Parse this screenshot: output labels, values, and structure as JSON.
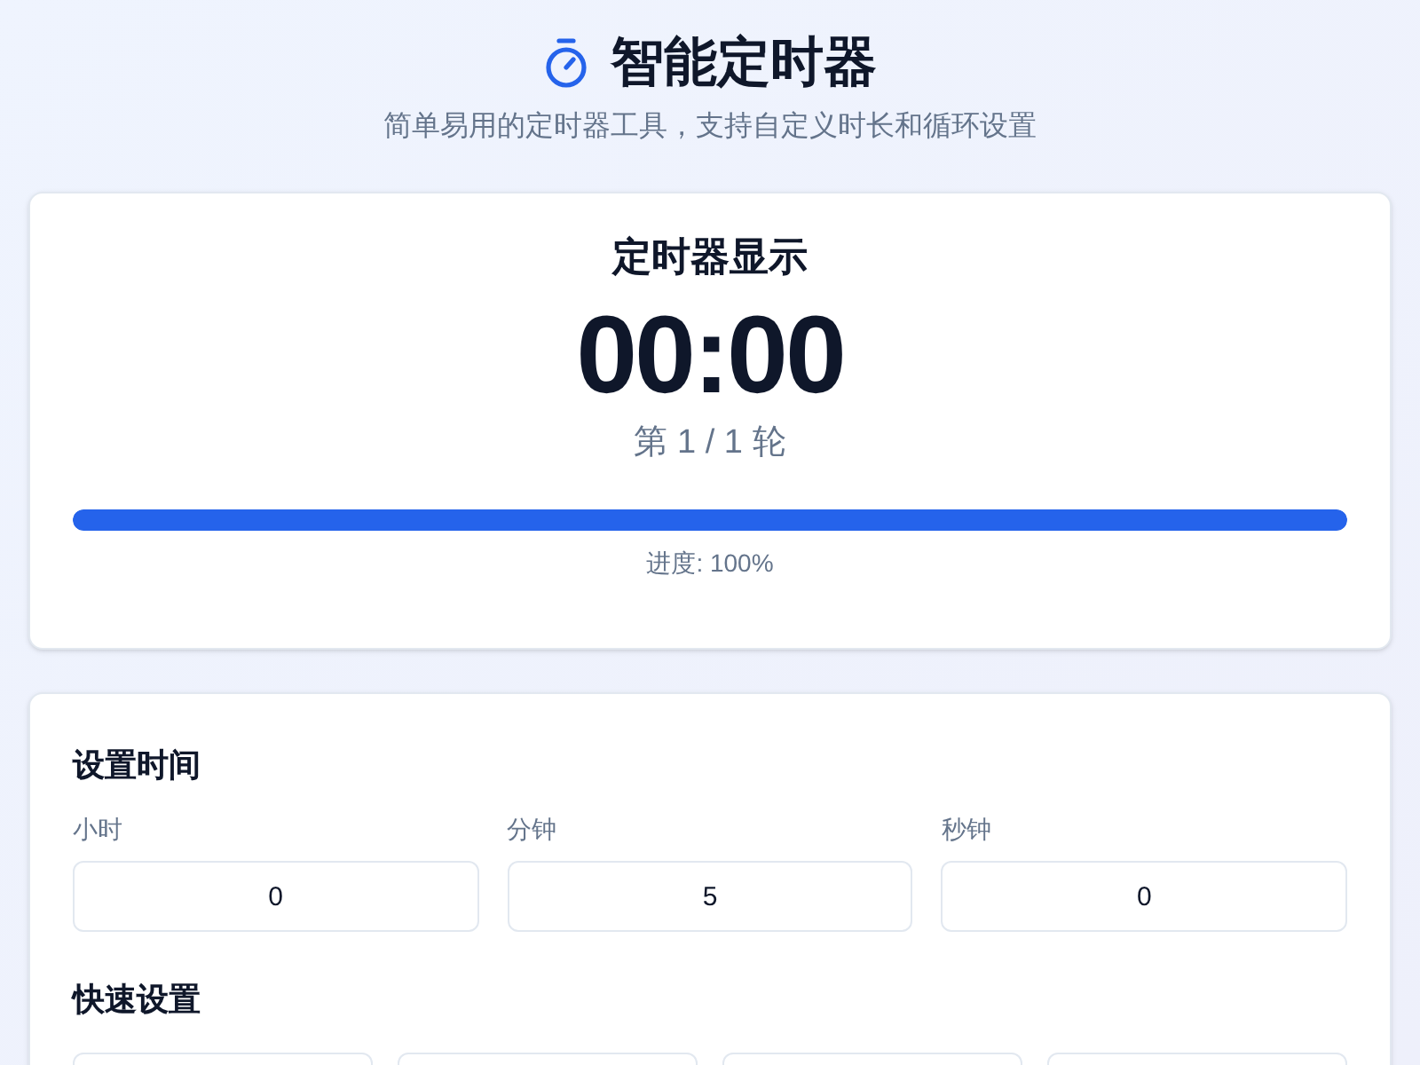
{
  "header": {
    "title": "智能定时器",
    "subtitle": "简单易用的定时器工具，支持自定义时长和循环设置"
  },
  "display": {
    "title": "定时器显示",
    "time": "00:00",
    "round": "第 1 / 1 轮",
    "level": 1,
    "progress_text": "进度: 100%"
  },
  "settings": {
    "title": "设置时间",
    "fields": [
      {
        "label": "小时",
        "value": "0"
      },
      {
        "label": "分钟",
        "value": "5"
      },
      {
        "label": "秒钟",
        "value": "0"
      }
    ]
  },
  "quick": {
    "title": "快速设置",
    "presets": [
      {
        "kind": "button"
      },
      {
        "kind": "button"
      },
      {
        "kind": "button"
      },
      {
        "kind": "button"
      }
    ]
  }
}
